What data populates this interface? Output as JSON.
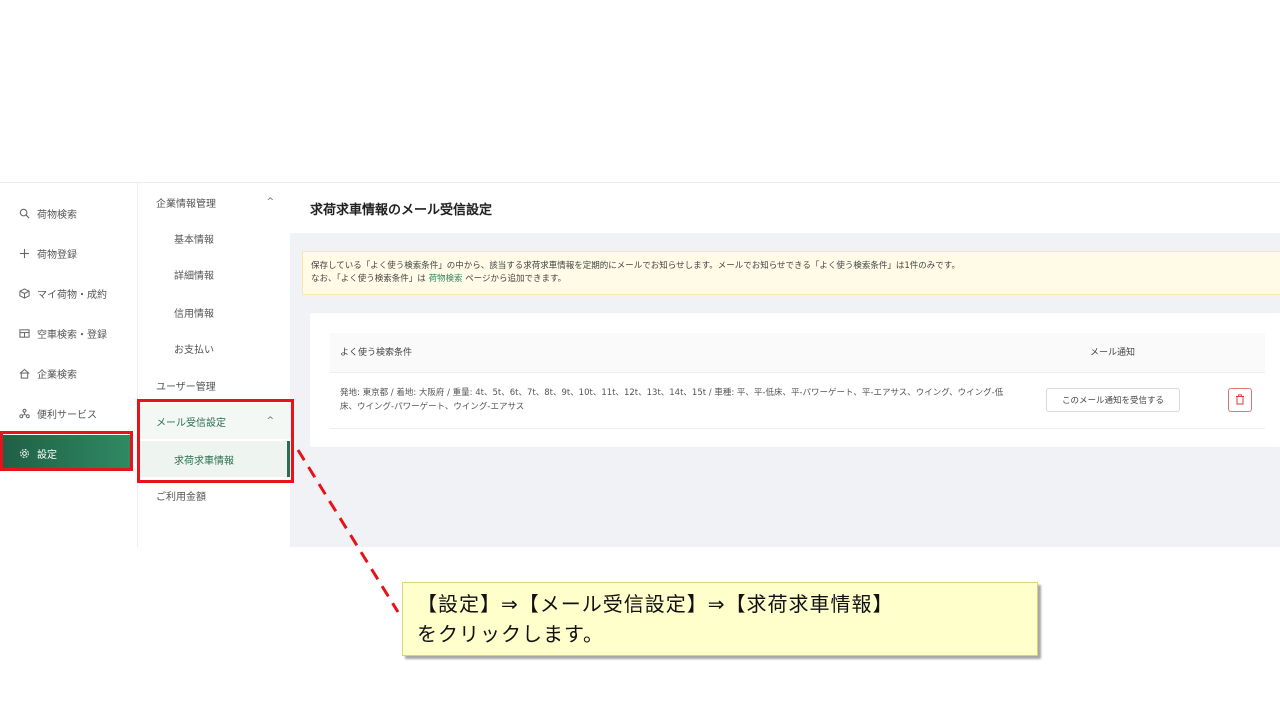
{
  "nav1": {
    "items": [
      {
        "label": "荷物検索",
        "icon": "search-icon"
      },
      {
        "label": "荷物登録",
        "icon": "plus-icon"
      },
      {
        "label": "マイ荷物・成約",
        "icon": "box-icon"
      },
      {
        "label": "空車検索・登録",
        "icon": "truck-icon"
      },
      {
        "label": "企業検索",
        "icon": "building-icon"
      },
      {
        "label": "便利サービス",
        "icon": "services-icon"
      },
      {
        "label": "設定",
        "icon": "gear-icon"
      }
    ]
  },
  "nav2": {
    "company_group": "企業情報管理",
    "company_items": [
      "基本情報",
      "詳細情報",
      "信用情報",
      "お支払い"
    ],
    "user_manage": "ユーザー管理",
    "mail_group": "メール受信設定",
    "mail_items": [
      "求荷求車情報"
    ],
    "usage": "ご利用金額"
  },
  "main": {
    "title": "求荷求車情報のメール受信設定",
    "notice_line1": "保存している「よく使う検索条件」の中から、該当する求荷求車情報を定期的にメールでお知らせします。メールでお知らせできる「よく使う検索条件」は1件のみです。",
    "notice_line2_pre": "なお、「よく使う検索条件」は ",
    "notice_link": "荷物検索",
    "notice_line2_post": " ページから追加できます。",
    "table": {
      "col_condition": "よく使う検索条件",
      "col_notify": "メール通知",
      "row_condition": "発地: 東京都 / 着地: 大阪府 / 重量: 4t、5t、6t、7t、8t、9t、10t、11t、12t、13t、14t、15t / 車種: 平、平-低床、平-パワーゲート、平-エアサス、ウイング、ウイング-低床、ウイング-パワーゲート、ウイング-エアサス",
      "receive_button": "このメール通知を受信する"
    }
  },
  "callout": {
    "line1": "【設定】⇒【メール受信設定】⇒【求荷求車情報】",
    "line2": "をクリックします。"
  },
  "colors": {
    "accent": "#2b6e52",
    "highlight": "#e5141a",
    "callout_bg": "#ffffcc"
  }
}
